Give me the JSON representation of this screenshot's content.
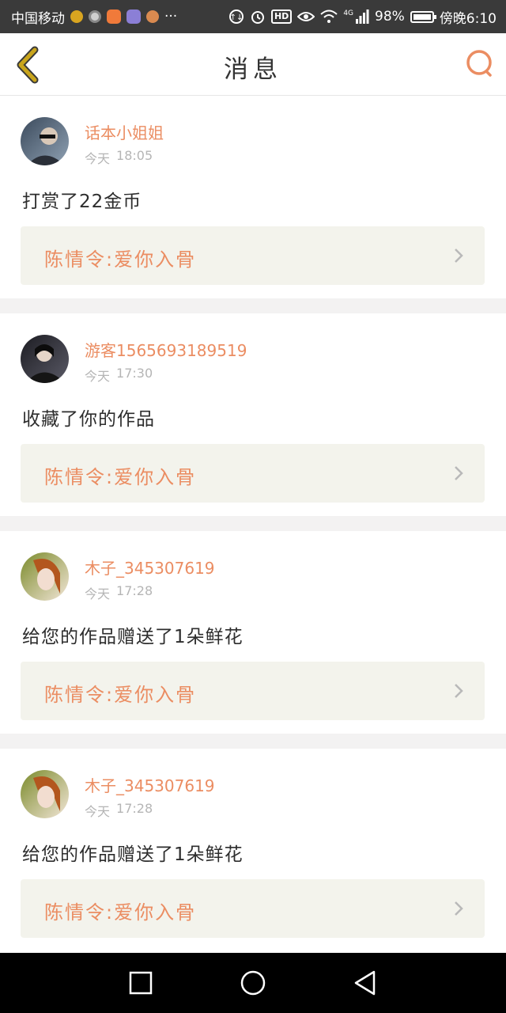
{
  "status_bar": {
    "carrier": "中国移动",
    "more": "···",
    "network": "4G",
    "battery": "98%",
    "time": "傍晚6:10",
    "hd": "HD"
  },
  "header": {
    "title": "消息",
    "back_icon": "chevron-left-icon",
    "search_icon": "search-icon"
  },
  "messages": [
    {
      "username": "话本小姐姐",
      "day": "今天",
      "time": "18:05",
      "text": "打赏了22金币",
      "work": "陈情令:爱你入骨",
      "avatar_colors": [
        "#3b4a5c",
        "#8fa1b3"
      ]
    },
    {
      "username": "游客1565693189519",
      "day": "今天",
      "time": "17:30",
      "text": "收藏了你的作品",
      "work": "陈情令:爱你入骨",
      "avatar_colors": [
        "#1c1c22",
        "#5a5a66"
      ]
    },
    {
      "username": "木子_345307619",
      "day": "今天",
      "time": "17:28",
      "text": "给您的作品赠送了1朵鲜花",
      "work": "陈情令:爱你入骨",
      "avatar_colors": [
        "#7a8a2a",
        "#f3e6d8"
      ]
    },
    {
      "username": "木子_345307619",
      "day": "今天",
      "time": "17:28",
      "text": "给您的作品赠送了1朵鲜花",
      "work": "陈情令:爱你入骨",
      "avatar_colors": [
        "#7a8a2a",
        "#f3e6d8"
      ]
    }
  ],
  "nav_bar": {
    "recent_icon": "square-icon",
    "home_icon": "circle-icon",
    "back_icon": "triangle-back-icon"
  },
  "colors": {
    "accent": "#eb8d62",
    "back_arrow": "#c9a51c",
    "card_bg": "#f3f3ec"
  }
}
